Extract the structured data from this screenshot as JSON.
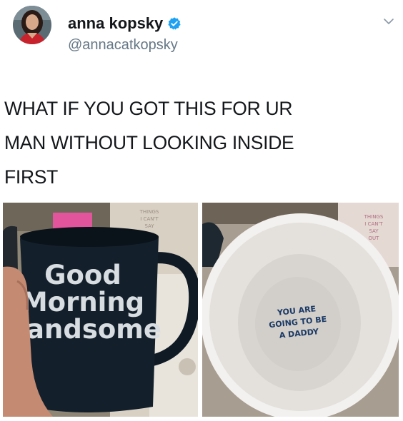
{
  "tweet": {
    "author": {
      "display_name": "anna kopsky",
      "handle": "@annacatkopsky",
      "verified": true
    },
    "text": "WHAT IF YOU GOT THIS FOR UR MAN WITHOUT LOOKING INSIDE FIRST",
    "text_lines": [
      "WHAT IF YOU GOT THIS FOR UR",
      "MAN WITHOUT LOOKING INSIDE",
      "FIRST"
    ],
    "media": [
      {
        "mug_text": [
          "Good",
          "Morning",
          "Handsome"
        ],
        "sign_text": [
          "THINGS",
          "I CAN'T",
          "SAY"
        ]
      },
      {
        "inside_text": [
          "YOU ARE",
          "GOING TO BE",
          "A DADDY"
        ],
        "sign_text": [
          "THINGS",
          "I CAN'T",
          "SAY",
          "OUT"
        ]
      }
    ]
  },
  "colors": {
    "verified": "#1da1f2",
    "text": "#14171a",
    "secondary": "#657786"
  },
  "icons": [
    "avatar",
    "verified-badge-icon",
    "chevron-down-icon"
  ]
}
